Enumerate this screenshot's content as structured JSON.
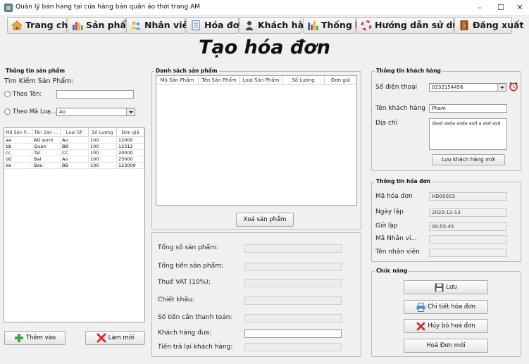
{
  "window": {
    "title": "Quản lý bán hàng tại cửa hàng bán quần áo thời trang AM",
    "minimize": "–",
    "maximize": "☐",
    "close": "✕"
  },
  "menu": [
    {
      "label": "Trang chủ",
      "icon": "home-icon"
    },
    {
      "label": "Sản phẩm",
      "icon": "bar-chart-icon"
    },
    {
      "label": "Nhân viên",
      "icon": "users-icon"
    },
    {
      "label": "Hóa đơn",
      "icon": "invoice-icon"
    },
    {
      "label": "Khách hàng",
      "icon": "customer-icon"
    },
    {
      "label": "Thống kê",
      "icon": "statistics-icon"
    },
    {
      "label": "Hướng dẫn sử dụng",
      "icon": "lifebuoy-icon"
    },
    {
      "label": "Đăng xuất",
      "icon": "logout-door-icon"
    }
  ],
  "page_title": "Tạo hóa đơn",
  "product_info": {
    "group_title": "Thông tin sản phẩm",
    "search_title": "Tìm Kiếm Sản Phẩm:",
    "by_name_label": "Theo Tên:",
    "by_name_value": "",
    "by_type_label": "Theo Mã Loạ...",
    "type_selected": "Ao",
    "columns": [
      "Mã Sản P...",
      "Tên Sản ...",
      "Loại SP",
      "Số Lượng",
      "Đơn giá"
    ],
    "rows": [
      [
        "aa",
        "AO somi",
        "Ao",
        "100",
        "12000"
      ],
      [
        "bb",
        "Quan",
        "BB",
        "100",
        "12312"
      ],
      [
        "cc",
        "Tat",
        "CC",
        "100",
        "20000"
      ],
      [
        "dd",
        "Bai",
        "Ao",
        "100",
        "25000"
      ],
      [
        "ee",
        "Bao",
        "BB",
        "100",
        "123000"
      ]
    ],
    "add_button": "Thêm vào",
    "refresh_button": "Làm mới"
  },
  "cart": {
    "group_title": "Danh sách sản phẩm",
    "columns": [
      "Mã Sản Phẩm",
      "Tên Sản Phẩm",
      "Loại Sản Phẩm",
      "Số Lượng",
      "Đơn giá"
    ],
    "delete_button": "Xoá sản phẩm"
  },
  "totals": {
    "total_qty_label": "Tổng số sản phẩm:",
    "total_amount_label": "Tổng tiền sản phẩm:",
    "vat_label": "Thuế VAT (10%):",
    "discount_label": "Chiết khấu:",
    "to_pay_label": "Số tiền cần thanh toán:",
    "paid_label": "Khách hàng đưa:",
    "change_label": "Tiền trả lại khách hàng:"
  },
  "customer": {
    "group_title": "Thông tin khách hàng",
    "phone_label": "Số điện thoại",
    "phone_value": "0232154456",
    "name_label": "Tên khách hàng",
    "name_value": "Pham",
    "address_label": "Địa chỉ",
    "address_value": "dasd asda asda asd a asd asd",
    "save_button": "Lưu khách hàng mới"
  },
  "invoice": {
    "group_title": "Thông tin hóa đơn",
    "id_label": "Mã hóa đơn",
    "id_value": "HD00003",
    "date_label": "Ngày lập",
    "date_value": "2022-12-13",
    "time_label": "Giờ lập",
    "time_value": "00:55:45",
    "staff_id_label": "Mã Nhân vi...",
    "staff_name_label": "Tên nhân viên"
  },
  "actions": {
    "group_title": "Chức năng",
    "save": "Lưu",
    "detail": "Chi tiết hóa đơn",
    "cancel": "Hủy bỏ hoá đơn",
    "new": "Hoá Đơn mới"
  },
  "colors": {
    "accent_blue": "#2f6fd0",
    "plus_green": "#3aa83a",
    "cancel_red": "#e02a2a",
    "alarm_red": "#d32020"
  }
}
